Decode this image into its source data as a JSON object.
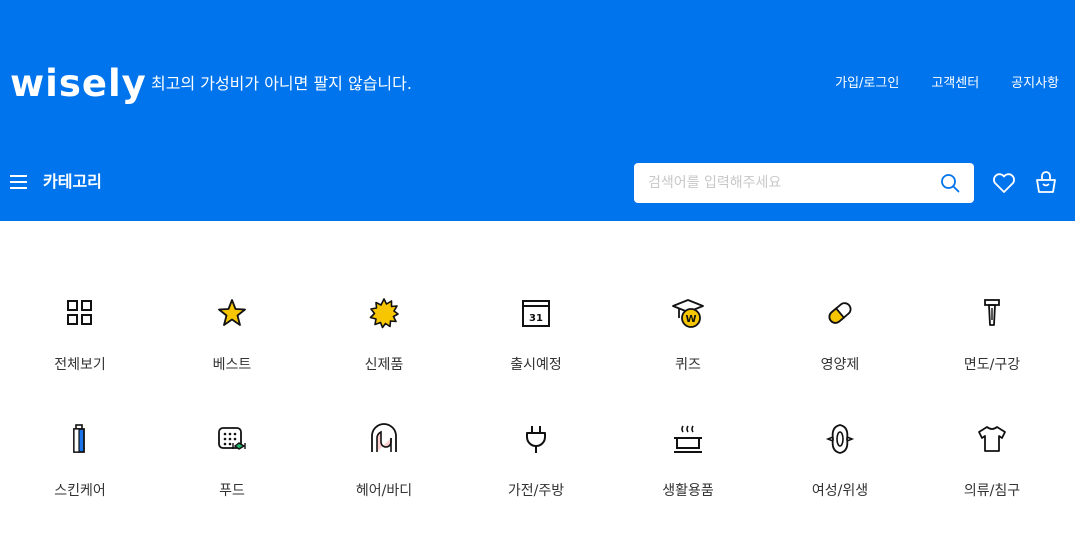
{
  "header": {
    "logo": "wisely",
    "slogan": "최고의 가성비가 아니면 팔지 않습니다.",
    "links": [
      "가입/로그인",
      "고객센터",
      "공지사항"
    ],
    "category_label": "카테고리",
    "search_placeholder": "검색어를 입력해주세요",
    "brand_color": "#0074ec"
  },
  "categories": [
    {
      "label": "전체보기",
      "icon": "grid-icon"
    },
    {
      "label": "베스트",
      "icon": "star-icon"
    },
    {
      "label": "신제품",
      "icon": "new-badge-icon"
    },
    {
      "label": "출시예정",
      "icon": "calendar-icon"
    },
    {
      "label": "퀴즈",
      "icon": "graduation-cap-icon"
    },
    {
      "label": "영양제",
      "icon": "pill-icon"
    },
    {
      "label": "면도/구강",
      "icon": "razor-icon"
    },
    {
      "label": "스킨케어",
      "icon": "lotion-bottle-icon"
    },
    {
      "label": "푸드",
      "icon": "food-icon"
    },
    {
      "label": "헤어/바디",
      "icon": "hair-icon"
    },
    {
      "label": "가전/주방",
      "icon": "plug-icon"
    },
    {
      "label": "생활용품",
      "icon": "pot-icon"
    },
    {
      "label": "여성/위생",
      "icon": "pad-icon"
    },
    {
      "label": "의류/침구",
      "icon": "tshirt-icon"
    }
  ],
  "calendar_day": "31",
  "quiz_letter": "W"
}
